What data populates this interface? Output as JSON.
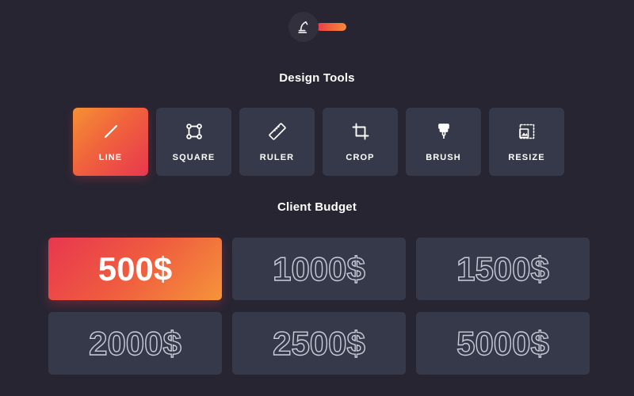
{
  "brand": {
    "logo_icon": "microscope-icon",
    "accent_start": "#e8374f",
    "accent_end": "#f5943a"
  },
  "sections": {
    "tools_title": "Design Tools",
    "budget_title": "Client Budget"
  },
  "tools": [
    {
      "label": "LINE",
      "icon": "diagonal-line-icon",
      "selected": true
    },
    {
      "label": "SQUARE",
      "icon": "square-nodes-icon",
      "selected": false
    },
    {
      "label": "RULER",
      "icon": "ruler-icon",
      "selected": false
    },
    {
      "label": "CROP",
      "icon": "crop-icon",
      "selected": false
    },
    {
      "label": "BRUSH",
      "icon": "brush-icon",
      "selected": false
    },
    {
      "label": "RESIZE",
      "icon": "resize-image-icon",
      "selected": false
    }
  ],
  "budgets": [
    {
      "label": "500$",
      "selected": true
    },
    {
      "label": "1000$",
      "selected": false
    },
    {
      "label": "1500$",
      "selected": false
    },
    {
      "label": "2000$",
      "selected": false
    },
    {
      "label": "2500$",
      "selected": false
    },
    {
      "label": "5000$",
      "selected": false
    }
  ]
}
